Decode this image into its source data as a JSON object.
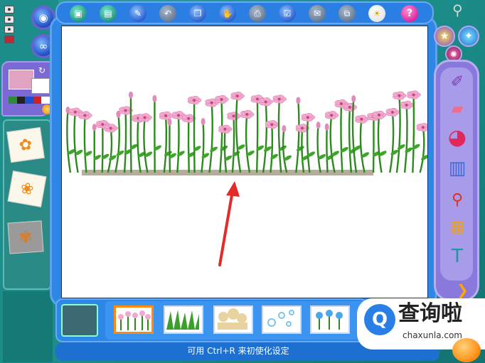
{
  "toolbar": {
    "icons": [
      "new-file",
      "open-file",
      "save-file",
      "undo",
      "copy",
      "edit",
      "print",
      "checklist",
      "email",
      "export",
      "idea",
      "help"
    ],
    "help_label": "?"
  },
  "left": {
    "mini_buttons": [
      "▪",
      "▪",
      "▪",
      "▪"
    ],
    "palette_colors": [
      "#e2a3c2",
      "#ffffff",
      "#2a8a3a",
      "#222222",
      "#1a4fd0",
      "#d02020"
    ]
  },
  "canvas": {
    "background": "#ffffff",
    "flower_color": "#f2a8cf",
    "stem_color": "#2c8a1f",
    "arrow_color": "#e52a2a"
  },
  "stamps": [
    "flowers-pink",
    "grass",
    "sand-flowers",
    "bubbles",
    "flowers-blue"
  ],
  "status": {
    "text": "可用 Ctrl+R 来初使化设定"
  },
  "watermark": {
    "logo": "Q",
    "title": "查询啦",
    "url": "chaxunla.com"
  }
}
